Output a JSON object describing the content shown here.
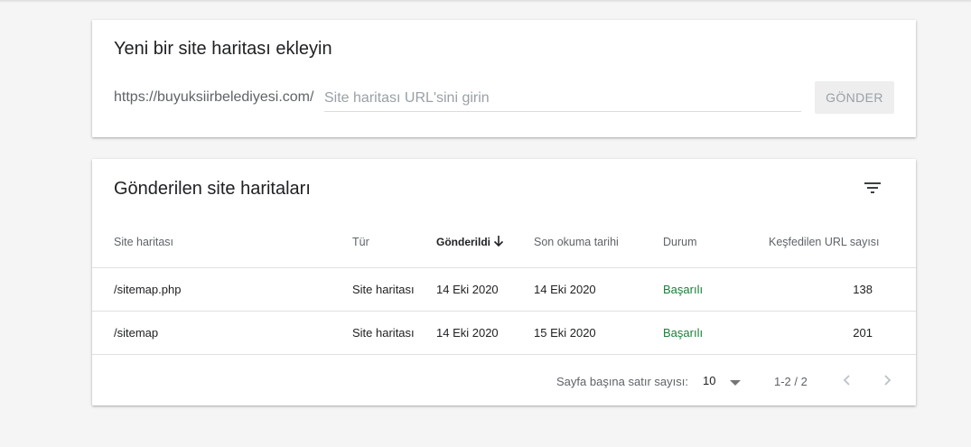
{
  "add_sitemap": {
    "title": "Yeni bir site haritası ekleyin",
    "url_prefix": "https://buyuksiirbelediyesi.com/",
    "input_placeholder": "Site haritası URL'sini girin",
    "input_value": "",
    "submit_label": "GÖNDER"
  },
  "submitted": {
    "title": "Gönderilen site haritaları",
    "filter_icon": "filter-icon",
    "columns": {
      "sitemap": "Site haritası",
      "type": "Tür",
      "submitted": "Gönderildi",
      "last_read": "Son okuma tarihi",
      "status": "Durum",
      "discovered": "Keşfedilen URL sayısı"
    },
    "sort": {
      "column": "submitted",
      "direction": "descending",
      "icon": "arrow-down-icon"
    },
    "rows": [
      {
        "sitemap": "/sitemap.php",
        "type": "Site haritası",
        "submitted": "14 Eki 2020",
        "last_read": "14 Eki 2020",
        "status": "Başarılı",
        "discovered": "138"
      },
      {
        "sitemap": "/sitemap",
        "type": "Site haritası",
        "submitted": "14 Eki 2020",
        "last_read": "15 Eki 2020",
        "status": "Başarılı",
        "discovered": "201"
      }
    ],
    "pagination": {
      "rows_per_page_label": "Sayfa başına satır sayısı:",
      "rows_per_page_value": "10",
      "range_label": "1-2 / 2"
    }
  },
  "colors": {
    "background": "#f5f5f5",
    "card": "#ffffff",
    "status_success": "#188038",
    "muted_text": "#5f6368"
  }
}
